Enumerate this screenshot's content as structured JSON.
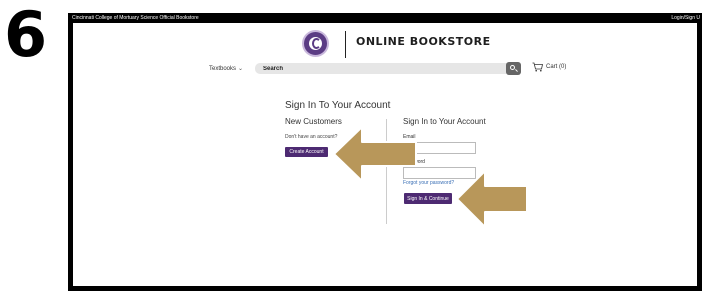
{
  "step": {
    "number": "6"
  },
  "topbar": {
    "site_name": "Cincinnati College of Mortuary Science Official Bookstore",
    "login_label": "Login/Sign U"
  },
  "header": {
    "store_title": "ONLINE BOOKSTORE",
    "logo_icon": "college-seal-logo",
    "brand_color": "#5b3c84"
  },
  "nav": {
    "textbooks_label": "Textbooks",
    "search_placeholder": "Search",
    "search_icon": "search-icon",
    "cart_label": "Cart (0)",
    "cart_icon": "shopping-cart-icon"
  },
  "signin": {
    "heading": "Sign In To Your Account",
    "new_customers": {
      "title": "New Customers",
      "prompt": "Don't have an account?",
      "create_button": "Create Account"
    },
    "existing": {
      "title": "Sign In to Your Account",
      "email_label": "Email",
      "email_value": "",
      "password_label": "Password",
      "password_value": "",
      "forgot_link": "Forgot your password?",
      "signin_button": "Sign In & Continue"
    }
  },
  "annotations": {
    "arrow_color": "#b8975a",
    "arrow_outline": "#ffffff",
    "arrows": [
      "pointer-arrow-create-account",
      "pointer-arrow-sign-in"
    ]
  }
}
